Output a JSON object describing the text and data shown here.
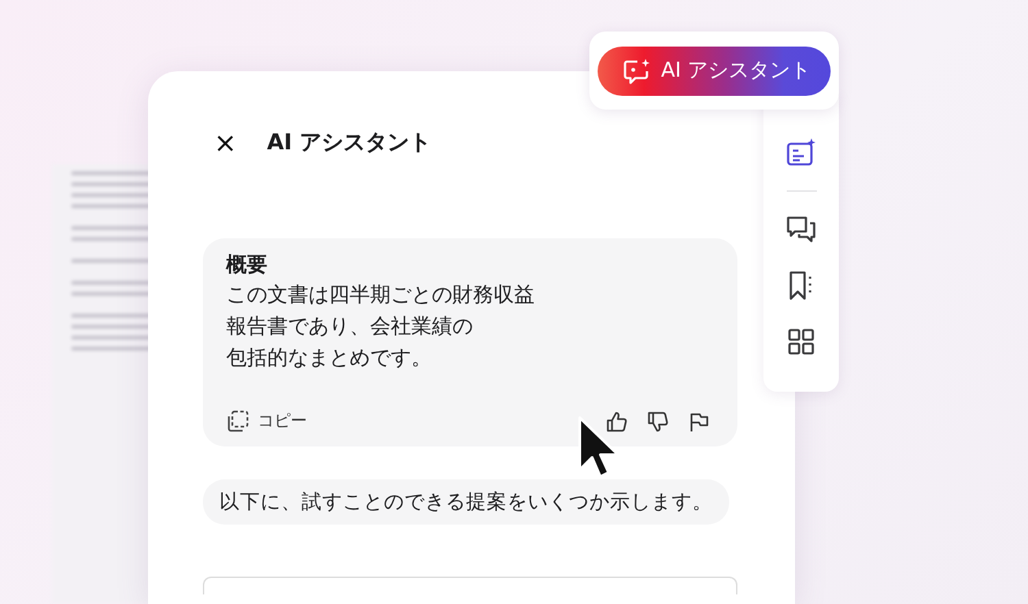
{
  "assistant_button": {
    "label": "AI アシスタント"
  },
  "panel": {
    "close": "×",
    "title": "AI アシスタント"
  },
  "summary": {
    "heading": "概要",
    "lines": [
      "この文書は四半期ごとの財務収益",
      "報告書であり、会社業績の",
      "包括的なまとめです。"
    ],
    "copy": "コピー"
  },
  "suggestion": "以下に、試すことのできる提案をいくつか示します。",
  "sidebar": {
    "items": [
      {
        "kind": "assistant",
        "selected": true
      },
      {
        "kind": "comments",
        "selected": false
      },
      {
        "kind": "bookmarks",
        "selected": false
      },
      {
        "kind": "apps",
        "selected": false
      }
    ]
  }
}
